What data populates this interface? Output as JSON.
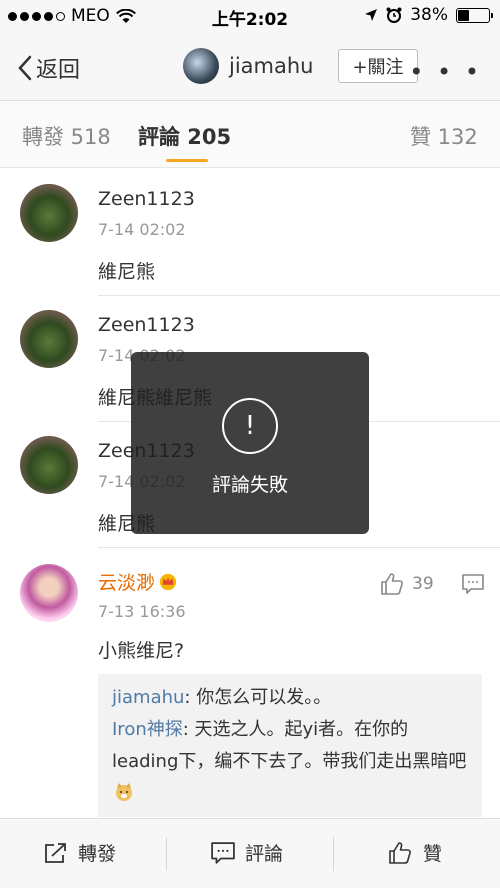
{
  "status_bar": {
    "carrier": "MEO",
    "time": "上午2:02",
    "battery": "38%",
    "battery_level": 0.38
  },
  "nav": {
    "back_label": "返回",
    "username": "jiamahu",
    "follow_label": "+關注",
    "more": "• • •"
  },
  "tabs": [
    {
      "label": "轉發 518"
    },
    {
      "label": "評論 205"
    },
    {
      "label": "贊 132"
    }
  ],
  "comments": [
    {
      "name": "Zeen1123",
      "date": "7-14 02:02",
      "text": "維尼熊"
    },
    {
      "name": "Zeen1123",
      "date": "7-14 02:02",
      "text": "維尼熊維尼熊"
    },
    {
      "name": "Zeen1123",
      "date": "7-14 02:02",
      "text": "維尼熊"
    },
    {
      "name": "云淡渺",
      "date": "7-13 16:36",
      "text": "小熊维尼?",
      "likes": "39"
    }
  ],
  "replies": [
    {
      "name": "jiamahu",
      "text": ": 你怎么可以发。。"
    },
    {
      "name": "Iron神探",
      "text": ": 天选之人。起yi者。在你的leading下，编不下去了。带我们走出黑暗吧"
    }
  ],
  "toast": {
    "icon": "!",
    "message": "評論失敗"
  },
  "bottom_bar": {
    "repost": "轉發",
    "comment": "評論",
    "like": "贊"
  }
}
